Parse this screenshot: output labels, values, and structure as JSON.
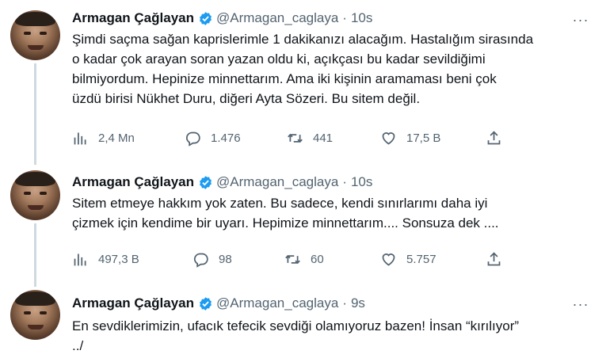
{
  "tweets": [
    {
      "name": "Armagan Çağlayan",
      "handle": "@Armagan_caglaya",
      "dot": "·",
      "time": "10s",
      "more": "···",
      "lines": [
        "Şimdi saçma sağan kaprislerimle 1 dakikanızı alacağım. Hastalığım sirasında",
        "o kadar çok arayan soran yazan oldu ki, açıkçası bu kadar sevildiğimi",
        "bilmiyordum. Hepinize minnettarım. Ama iki kişinin aramaması beni çok",
        "üzdü birisi Nükhet Duru, diğeri Ayta Sözeri. Bu sitem değil."
      ],
      "stats": {
        "views": "2,4 Mn",
        "replies": "1.476",
        "retweets": "441",
        "likes": "17,5 B"
      }
    },
    {
      "name": "Armagan Çağlayan",
      "handle": "@Armagan_caglaya",
      "dot": "·",
      "time": "10s",
      "more": "···",
      "lines": [
        "Sitem etmeye hakkım yok zaten. Bu sadece, kendi sınırlarımı daha iyi",
        "çizmek için kendime bir uyarı. Hepimize minnettarım.... Sonsuza dek ...."
      ],
      "stats": {
        "views": "497,3 B",
        "replies": "98",
        "retweets": "60",
        "likes": "5.757"
      }
    },
    {
      "name": "Armagan Çağlayan",
      "handle": "@Armagan_caglaya",
      "dot": "·",
      "time": "9s",
      "more": "···",
      "lines": [
        "En sevdiklerimizin, ufacık tefecik sevdiği olamıyoruz bazen! İnsan “kırılıyor”",
        "../"
      ]
    }
  ],
  "colors": {
    "verified": "#1d9bf0",
    "muted": "#536471",
    "text": "#0f1419",
    "thread": "#cfd9de"
  },
  "icons": [
    "views-icon",
    "reply-icon",
    "retweet-icon",
    "like-icon",
    "share-icon",
    "verified-badge-icon",
    "more-icon"
  ]
}
